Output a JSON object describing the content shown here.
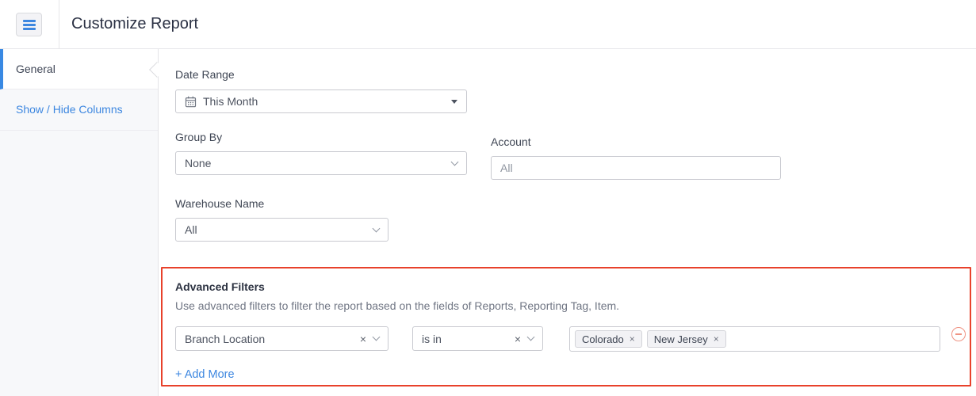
{
  "header": {
    "title": "Customize Report"
  },
  "sidebar": {
    "items": [
      {
        "label": "General",
        "active": true
      },
      {
        "label": "Show / Hide Columns",
        "active": false
      }
    ]
  },
  "form": {
    "date_range": {
      "label": "Date Range",
      "value": "This Month"
    },
    "group_by": {
      "label": "Group By",
      "value": "None"
    },
    "account": {
      "label": "Account",
      "value": "All"
    },
    "warehouse_name": {
      "label": "Warehouse Name",
      "value": "All"
    }
  },
  "advanced_filters": {
    "title": "Advanced Filters",
    "description": "Use advanced filters to filter the report based on the fields of Reports, Reporting Tag, Item.",
    "rows": [
      {
        "field": "Branch Location",
        "operator": "is in",
        "values": [
          "Colorado",
          "New Jersey"
        ]
      }
    ],
    "add_more_label": "+ Add More"
  },
  "icons": {
    "menu": "hamburger-icon",
    "calendar": "calendar-icon",
    "caret": "caret-down-icon",
    "chevron": "chevron-down-icon",
    "clear": "clear-x-icon",
    "remove_row": "remove-circle-icon",
    "close_glyph": "×"
  },
  "colors": {
    "accent_blue": "#3d87e0",
    "link_blue": "#3d87e0",
    "highlight_red": "#e8412b",
    "remove_icon_red": "#ef9383",
    "sidebar_bg": "#f7f8fa"
  }
}
